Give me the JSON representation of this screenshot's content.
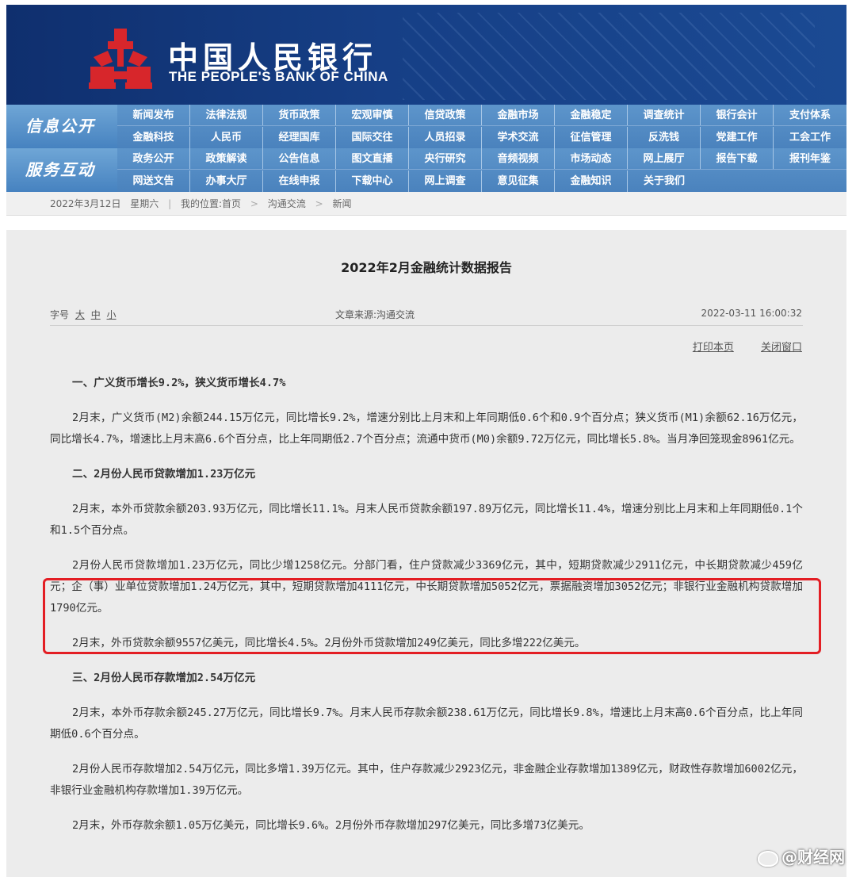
{
  "header": {
    "bank_name_cn": "中国人民银行",
    "bank_name_en": "THE PEOPLE'S BANK OF CHINA",
    "brand_color": "#163f86",
    "logo_color": "#d7262b"
  },
  "nav": {
    "label1": "信息公开",
    "label2": "服务互动",
    "row1": [
      "新闻发布",
      "法律法规",
      "货币政策",
      "宏观审慎",
      "信贷政策",
      "金融市场",
      "金融稳定",
      "调查统计",
      "银行会计",
      "支付体系"
    ],
    "row2": [
      "金融科技",
      "人民币",
      "经理国库",
      "国际交往",
      "人员招录",
      "学术交流",
      "征信管理",
      "反洗钱",
      "党建工作",
      "工会工作"
    ],
    "row3": [
      "政务公开",
      "政策解读",
      "公告信息",
      "图文直播",
      "央行研究",
      "音频视频",
      "市场动态",
      "网上展厅",
      "报告下载",
      "报刊年鉴"
    ],
    "row4": [
      "网送文告",
      "办事大厅",
      "在线申报",
      "下载中心",
      "网上调查",
      "意见征集",
      "金融知识",
      "关于我们"
    ]
  },
  "breadcrumb": {
    "date": "2022年3月12日",
    "weekday": "星期六",
    "location_label": "我的位置:首页",
    "level1": "沟通交流",
    "level2": "新闻"
  },
  "article": {
    "title": "2022年2月金融统计数据报告",
    "font_label": "字号",
    "font_large": "大",
    "font_medium": "中",
    "font_small": "小",
    "source": "文章来源:沟通交流",
    "datetime": "2022-03-11 16:00:32",
    "print": "打印本页",
    "close": "关闭窗口",
    "h1": "一、广义货币增长9.2%，狭义货币增长4.7%",
    "p1": "2月末，广义货币(M2)余额244.15万亿元，同比增长9.2%，增速分别比上月末和上年同期低0.6个和0.9个百分点；狭义货币(M1)余额62.16万亿元，同比增长4.7%，增速比上月末高6.6个百分点，比上年同期低2.7个百分点；流通中货币(M0)余额9.72万亿元，同比增长5.8%。当月净回笼现金8961亿元。",
    "h2": "二、2月份人民币贷款增加1.23万亿元",
    "p2": "2月末，本外币贷款余额203.93万亿元，同比增长11.1%。月末人民币贷款余额197.89万亿元，同比增长11.4%，增速分别比上月末和上年同期低0.1个和1.5个百分点。",
    "p3": "2月份人民币贷款增加1.23万亿元，同比少增1258亿元。分部门看，住户贷款减少3369亿元，其中，短期贷款减少2911亿元，中长期贷款减少459亿元；企（事）业单位贷款增加1.24万亿元，其中，短期贷款增加4111亿元，中长期贷款增加5052亿元，票据融资增加3052亿元；非银行业金融机构贷款增加1790亿元。",
    "p4": "2月末，外币贷款余额9557亿美元，同比增长4.5%。2月份外币贷款增加249亿美元，同比多增222亿美元。",
    "h3": "三、2月份人民币存款增加2.54万亿元",
    "p5": "2月末，本外币存款余额245.27万亿元，同比增长9.7%。月末人民币存款余额238.61万亿元，同比增长9.8%，增速比上月末高0.6个百分点，比上年同期低0.6个百分点。",
    "p6": "2月份人民币存款增加2.54万亿元，同比多增1.39万亿元。其中，住户存款减少2923亿元，非金融企业存款增加1389亿元，财政性存款增加6002亿元，非银行业金融机构存款增加1.39万亿元。",
    "p7": "2月末，外币存款余额1.05万亿美元，同比增长9.6%。2月份外币存款增加297亿美元，同比多增73亿美元。"
  },
  "watermark": "@财经网",
  "highlight_color": "#e31e24"
}
